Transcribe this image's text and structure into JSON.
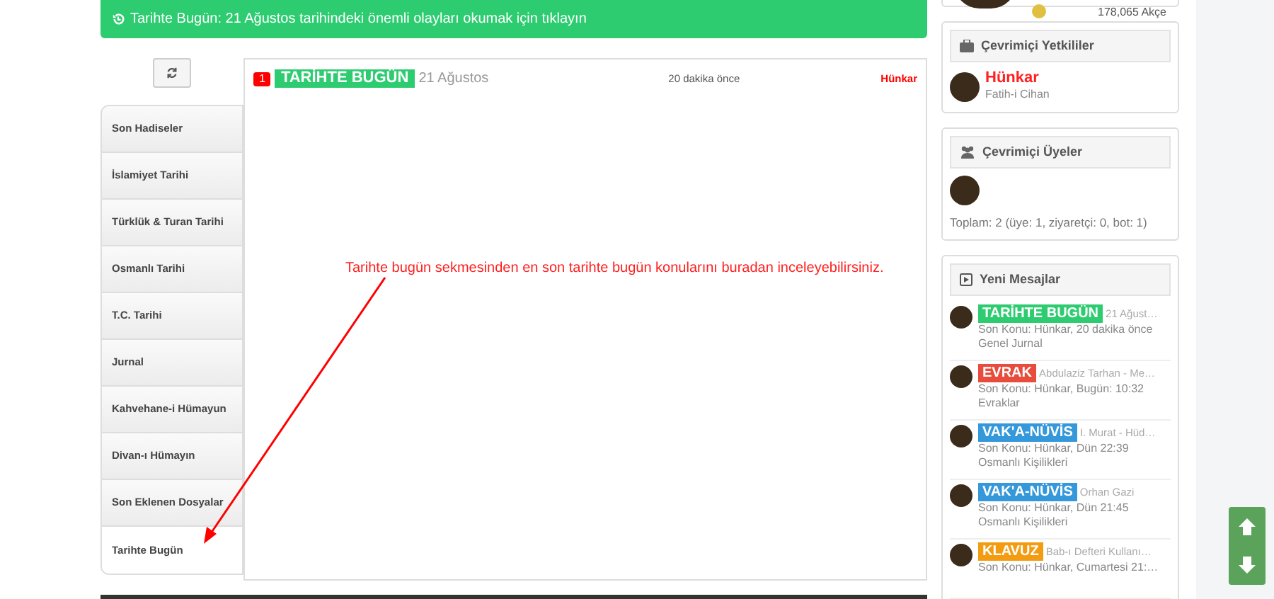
{
  "banner": {
    "text": "Tarihte Bugün: 21 Ağustos tarihindeki önemli olayları okumak için tıklayın"
  },
  "tabs": [
    {
      "label": "Son Hadiseler",
      "selected": false
    },
    {
      "label": "İslamiyet Tarihi",
      "selected": false
    },
    {
      "label": "Türklük & Turan Tarihi",
      "selected": false
    },
    {
      "label": "Osmanlı Tarihi",
      "selected": false
    },
    {
      "label": "T.C. Tarihi",
      "selected": false
    },
    {
      "label": "Jurnal",
      "selected": false
    },
    {
      "label": "Kahvehane-i Hümayun",
      "selected": false
    },
    {
      "label": "Divan-ı Hümayın",
      "selected": false
    },
    {
      "label": "Son Eklenen Dosyalar",
      "selected": false
    },
    {
      "label": "Tarihte Bugün",
      "selected": true
    }
  ],
  "topics": [
    {
      "count": "1",
      "prefix": "TARİHTE BUGÜN",
      "title": "21 Ağustos",
      "time": "20 dakika önce",
      "author": "Hünkar"
    }
  ],
  "annotation": {
    "text": "Tarihte bugün sekmesinden en son tarihte bugün konularını buradan inceleyebilirsiniz."
  },
  "profile_card": {
    "currency": "178,065 Akçe"
  },
  "staff_card": {
    "title": "Çevrimiçi Yetkililer",
    "users": [
      {
        "name": "Hünkar",
        "rank": "Fatih-i Cihan"
      }
    ]
  },
  "members_card": {
    "title": "Çevrimiçi Üyeler",
    "summary": "Toplam: 2 (üye: 1, ziyaretçi: 0, bot: 1)"
  },
  "messages_card": {
    "title": "Yeni Mesajlar",
    "items": [
      {
        "prefix": "TARİHTE BUGÜN",
        "color": "#2ecc71",
        "title": "21 Ağust…",
        "last": "Son Konu: Hünkar, 20 dakika önce",
        "forum": "Genel Jurnal"
      },
      {
        "prefix": "EVRAK",
        "color": "#e74c3c",
        "title": "Abdulaziz Tarhan - Me…",
        "last": "Son Konu: Hünkar, Bugün: 10:32",
        "forum": "Evraklar"
      },
      {
        "prefix": "VAK'A-NÜVİS",
        "color": "#3498db",
        "title": "I. Murat - Hüd…",
        "last": "Son Konu: Hünkar, Dün 22:39",
        "forum": "Osmanlı Kişilikleri"
      },
      {
        "prefix": "VAK'A-NÜVİS",
        "color": "#3498db",
        "title": "Orhan Gazi",
        "last": "Son Konu: Hünkar, Dün 21:45",
        "forum": "Osmanlı Kişilikleri"
      },
      {
        "prefix": "KLAVUZ",
        "color": "#f39c12",
        "title": "Bab-ı Defteri Kullanı…",
        "last": "Son Konu: Hünkar, Cumartesi 21:…"
      }
    ]
  }
}
